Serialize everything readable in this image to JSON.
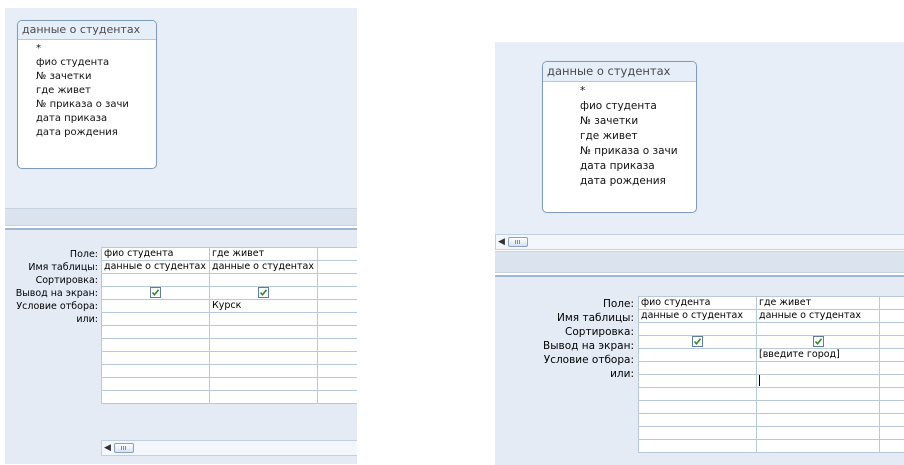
{
  "left": {
    "table_title": "данные о  студентах",
    "fields": [
      "*",
      "фио студента",
      "№ зачетки",
      "где  живет",
      "№ приказа  о зачи",
      "дата  приказа",
      "дата рождения"
    ],
    "row_labels": [
      "Поле:",
      "Имя таблицы:",
      "Сортировка:",
      "Вывод на экран:",
      "Условие отбора:",
      "или:"
    ],
    "columns": [
      {
        "field": "фио студента",
        "table": "данные о  студентах",
        "sort": "",
        "show": true,
        "criteria": "",
        "or": ""
      },
      {
        "field": "где  живет",
        "table": "данные о  студентах",
        "sort": "",
        "show": true,
        "criteria": "Курск",
        "or": ""
      }
    ],
    "scroll_arrow": "◀"
  },
  "right": {
    "table_title": "данные о  студентах",
    "fields": [
      "*",
      "фио студента",
      "№ зачетки",
      "где  живет",
      "№ приказа  о зачи",
      "дата  приказа",
      "дата рождения"
    ],
    "row_labels": [
      "Поле:",
      "Имя таблицы:",
      "Сортировка:",
      "Вывод на экран:",
      "Условие отбора:",
      "или:"
    ],
    "columns": [
      {
        "field": "фио студента",
        "table": "данные о  студентах",
        "sort": "",
        "show": true,
        "criteria": "",
        "or": ""
      },
      {
        "field": "где  живет",
        "table": "данные о  студентах",
        "sort": "",
        "show": true,
        "criteria": "[введите город]",
        "or": ""
      }
    ],
    "scroll_arrow": "◀"
  },
  "colors": {
    "pane_bg": "#e8eef7",
    "grid_bg": "#e4ebf5",
    "accent": "#9eb6d4",
    "check": "#2e8b2e"
  }
}
